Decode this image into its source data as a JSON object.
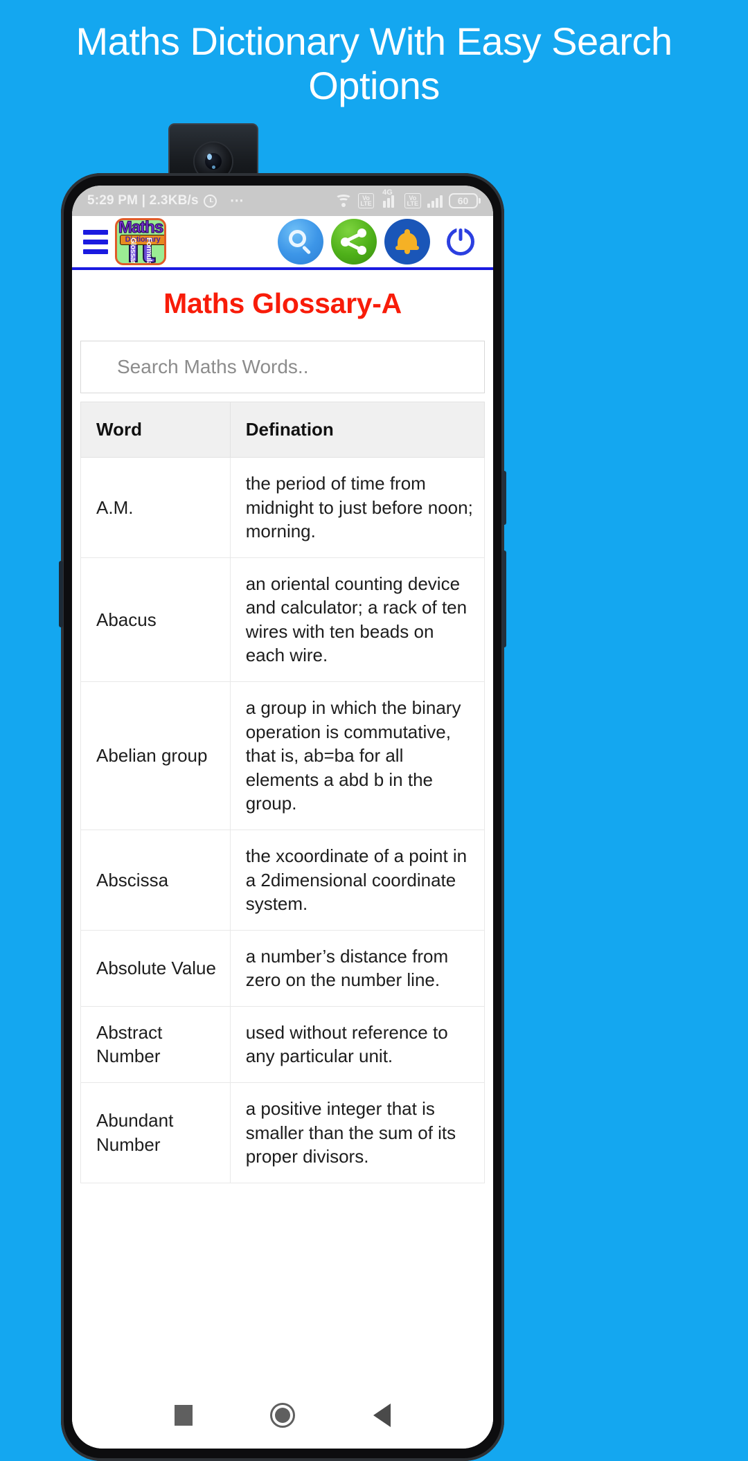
{
  "promo": {
    "headline": "Maths Dictionary With Easy Search Options"
  },
  "status_bar": {
    "clock_and_speed": "5:29 PM | 2.3KB/s",
    "alarm_icon": "alarm-clock-icon",
    "overflow_icon": "more-dots-icon",
    "wifi_icon": "wifi-icon",
    "volte_badge_1": "VoLTE",
    "network_label": "4G",
    "volte_badge_2": "VoLTE",
    "battery_level": "60"
  },
  "app_bar": {
    "menu_icon": "hamburger-menu-icon",
    "logo": {
      "title": "Maths",
      "subtitle": "Dictionary",
      "symbol": "π",
      "left_leg_label": "Glossary",
      "right_leg_label": "Formula"
    },
    "actions": [
      {
        "name": "search-button",
        "icon": "search-icon",
        "color": "#3d96e8"
      },
      {
        "name": "share-button",
        "icon": "share-icon",
        "color": "#4eb019"
      },
      {
        "name": "notification-button",
        "icon": "bell-icon",
        "color": "#1a56b8"
      },
      {
        "name": "power-button",
        "icon": "power-icon",
        "color": "#2b3fe0"
      }
    ]
  },
  "page": {
    "title": "Maths Glossary-A",
    "title_color": "#f81c09"
  },
  "search": {
    "placeholder": "Search Maths Words..",
    "value": ""
  },
  "table": {
    "headers": {
      "word": "Word",
      "definition": "Defination"
    },
    "rows": [
      {
        "word": "A.M.",
        "definition": "the period of time from midnight to just before noon; morning."
      },
      {
        "word": "Abacus",
        "definition": "an oriental counting device and calculator; a rack of ten wires with ten beads on each wire."
      },
      {
        "word": "Abelian group",
        "definition": "a group in which the binary operation is commutative, that is, ab=ba for all elements a abd b in the group."
      },
      {
        "word": "Abscissa",
        "definition": "the xcoordinate of a point in a 2dimensional coordinate system."
      },
      {
        "word": "Absolute Value",
        "definition": "a number’s distance from zero on the number line."
      },
      {
        "word": "Abstract Number",
        "definition": "used without reference to any particular unit."
      },
      {
        "word": "Abundant Number",
        "definition": "a positive integer that is smaller than the sum of its proper divisors."
      }
    ]
  },
  "nav_bar": {
    "recents_icon": "square-recents-icon",
    "home_icon": "circle-home-icon",
    "back_icon": "triangle-back-icon"
  }
}
